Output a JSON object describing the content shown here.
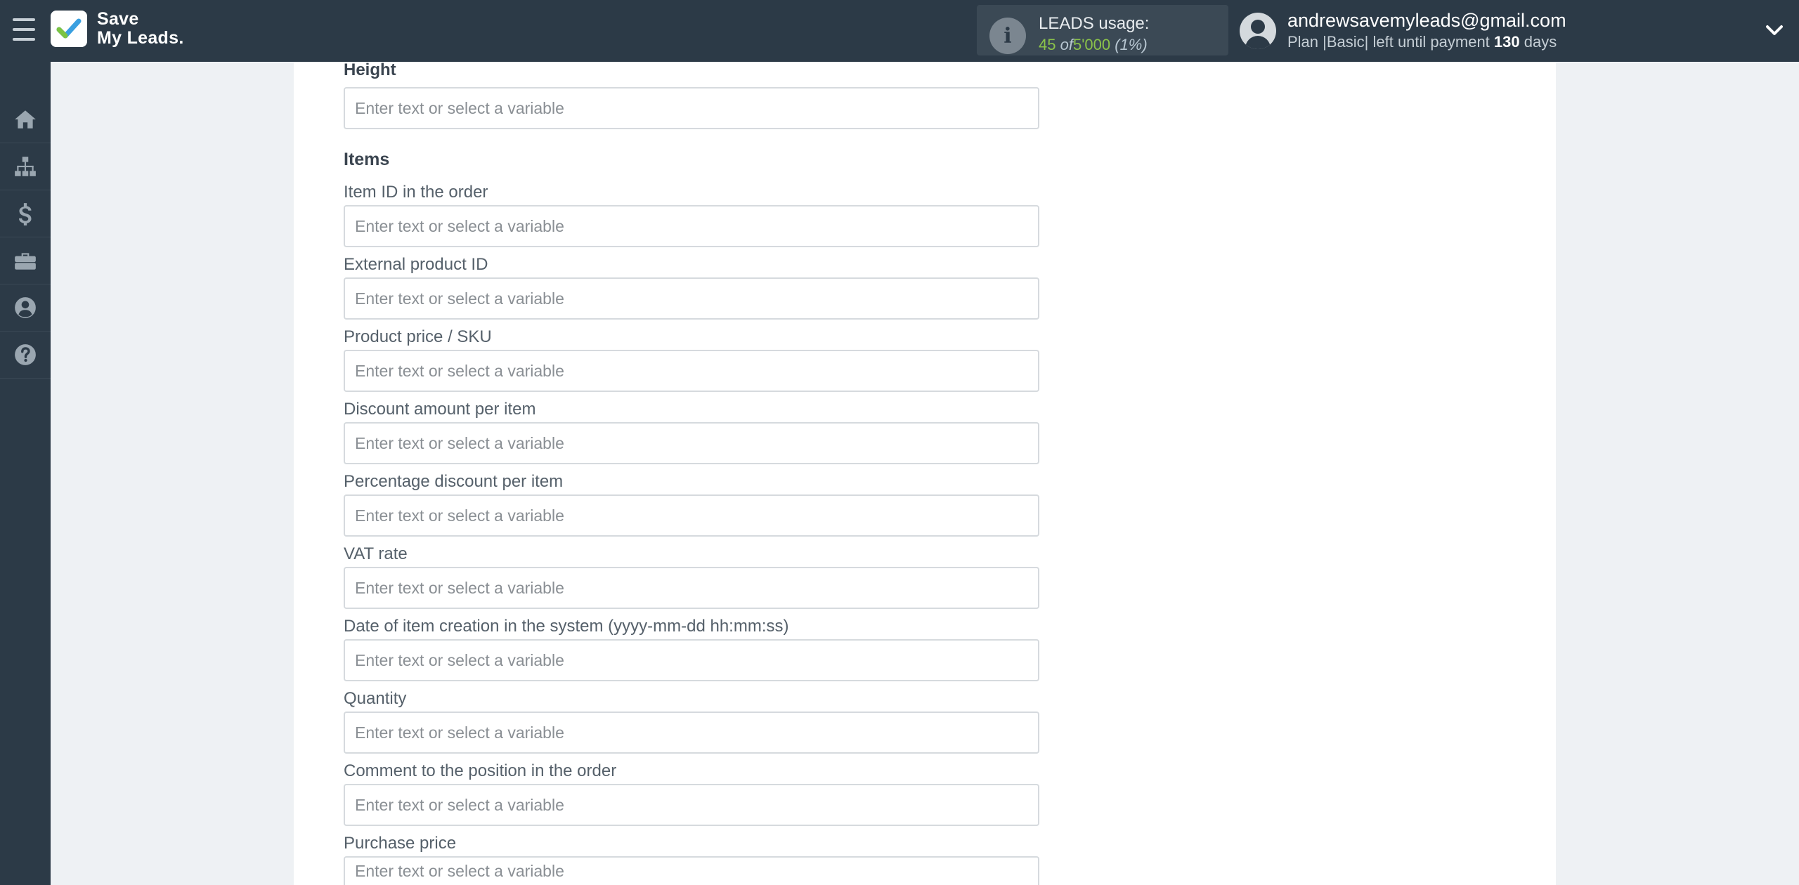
{
  "brand": {
    "line1": "Save",
    "line2": "My Leads."
  },
  "usage": {
    "title": "LEADS usage:",
    "used": "45",
    "of": "of",
    "total": "5'000",
    "percent": "(1%)"
  },
  "account": {
    "email": "andrewsavemyleads@gmail.com",
    "plan_prefix": "Plan |Basic| left until payment",
    "days": "130",
    "days_suffix": "days"
  },
  "sidebar": {
    "items": [
      {
        "icon": "home-icon"
      },
      {
        "icon": "sitemap-icon"
      },
      {
        "icon": "dollar-icon"
      },
      {
        "icon": "briefcase-icon"
      },
      {
        "icon": "user-circle-icon"
      },
      {
        "icon": "question-circle-icon"
      }
    ]
  },
  "form": {
    "placeholder": "Enter text or select a variable",
    "height_label": "Height",
    "items_section": "Items",
    "fields": [
      "Item ID in the order",
      "External product ID",
      "Product price / SKU",
      "Discount amount per item",
      "Percentage discount per item",
      "VAT rate",
      "Date of item creation in the system (yyyy-mm-dd hh:mm:ss)",
      "Quantity",
      "Comment to the position in the order",
      "Purchase price"
    ]
  },
  "colors": {
    "topbar": "#2c3a47",
    "accent_green": "#8bc34a",
    "card": "#ffffff"
  }
}
